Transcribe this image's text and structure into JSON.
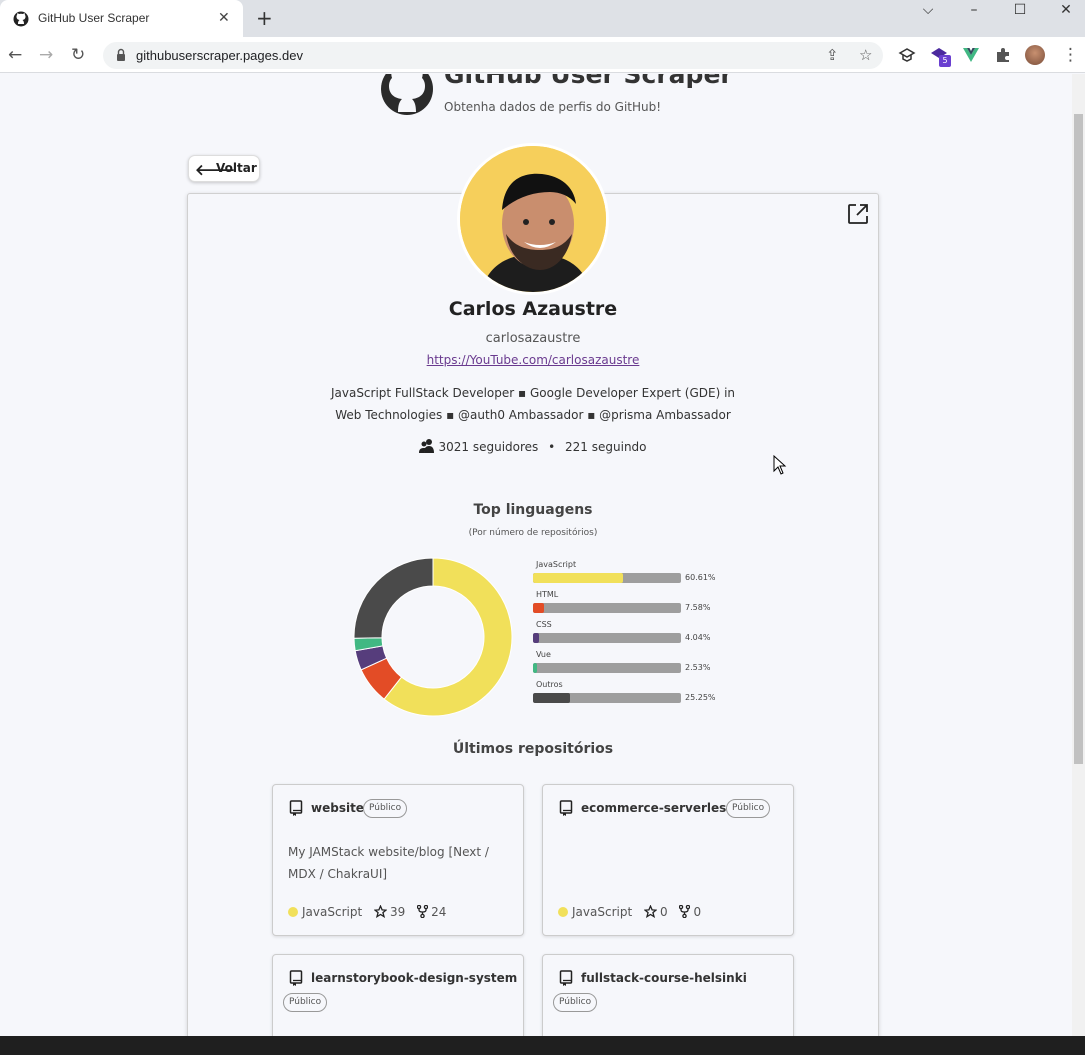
{
  "browser": {
    "tab_title": "GitHub User Scraper",
    "url": "githubuserscraper.pages.dev",
    "extension_badge": "5"
  },
  "header": {
    "title": "GitHub User Scraper",
    "subtitle": "Obtenha dados de perfis do GitHub!"
  },
  "back_button": {
    "label": "Voltar"
  },
  "profile": {
    "name": "Carlos Azaustre",
    "login": "carlosazaustre",
    "blog": "https://YouTube.com/carlosazaustre",
    "bio_line1": "JavaScript FullStack Developer ▪ Google Developer Expert (GDE) in",
    "bio_line2": "Web Technologies ▪ @auth0 Ambassador ▪ @prisma Ambassador",
    "followers": "3021 seguidores",
    "separator": "•",
    "following": "221 seguindo"
  },
  "languages": {
    "title": "Top linguagens",
    "subtitle": "(Por número de repositórios)",
    "items": [
      {
        "name": "JavaScript",
        "percent_label": "60.61%",
        "value": 60.61,
        "color": "#f1e05a"
      },
      {
        "name": "HTML",
        "percent_label": "7.58%",
        "value": 7.58,
        "color": "#e34c26"
      },
      {
        "name": "CSS",
        "percent_label": "4.04%",
        "value": 4.04,
        "color": "#563d7c"
      },
      {
        "name": "Vue",
        "percent_label": "2.53%",
        "value": 2.53,
        "color": "#41b883"
      },
      {
        "name": "Outros",
        "percent_label": "25.25%",
        "value": 25.25,
        "color": "#4a4a4a"
      }
    ]
  },
  "repos": {
    "title": "Últimos repositórios",
    "items": [
      {
        "name": "website",
        "visibility": "Público",
        "description": "My JAMStack website/blog [Next / MDX / ChakraUI]",
        "language": "JavaScript",
        "stars": "39",
        "forks": "24"
      },
      {
        "name": "ecommerce-serverless",
        "visibility": "Público",
        "description": "",
        "language": "JavaScript",
        "stars": "0",
        "forks": "0"
      },
      {
        "name": "learnstorybook-design-system",
        "visibility": "Público"
      },
      {
        "name": "fullstack-course-helsinki",
        "visibility": "Público"
      }
    ]
  }
}
